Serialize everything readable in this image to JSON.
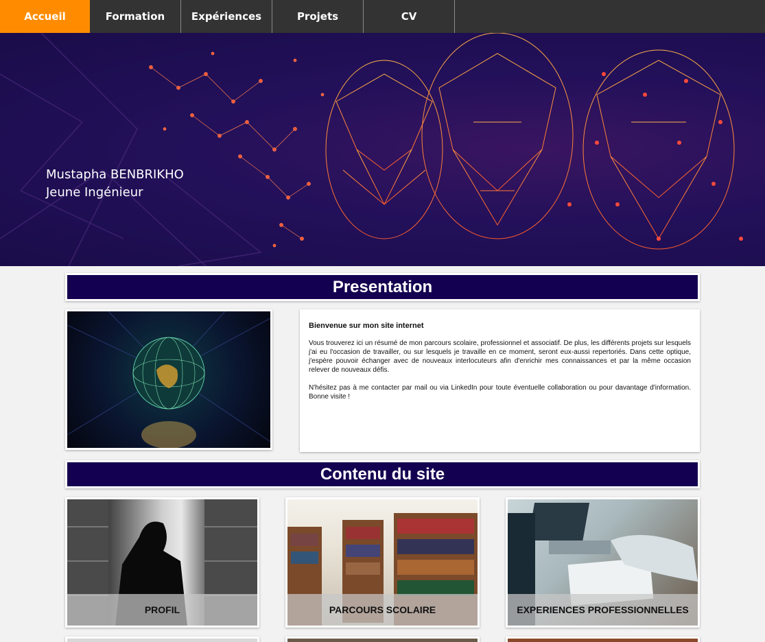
{
  "nav": {
    "items": [
      {
        "label": "Accueil"
      },
      {
        "label": "Formation"
      },
      {
        "label": "Expériences"
      },
      {
        "label": "Projets"
      },
      {
        "label": "CV"
      }
    ],
    "active_color": "#ff8c00",
    "background": "#333333"
  },
  "hero": {
    "name": "Mustapha BENBRIKHO",
    "subtitle": "Jeune Ingénieur"
  },
  "presentation": {
    "title": "Presentation",
    "welcome": "Bienvenue sur mon site internet",
    "paragraph1": "Vous trouverez ici un résumé de mon parcours scolaire, professionnel et associatif. De plus, les différents projets sur lesquels j'ai eu l'occasion de travailler, ou sur lesquels je travaille en ce moment, seront eux-aussi repertoriés. Dans cette optique, j'espère pouvoir échanger avec de nouveaux interlocuteurs afin d'enrichir mes connaissances et par la même occasion relever de nouveaux défis.",
    "paragraph2": "N'hésitez pas à me contacter par mail ou via LinkedIn pour toute éventuelle collaboration ou pour davantage d'information. Bonne visite !"
  },
  "content": {
    "title": "Contenu du site",
    "cards": [
      {
        "label": "PROFIL"
      },
      {
        "label": "PARCOURS SCOLAIRE"
      },
      {
        "label": "EXPERIENCES PROFESSIONNELLES"
      }
    ]
  },
  "colors": {
    "header_bar": "#140050",
    "accent": "#ff8c00"
  }
}
